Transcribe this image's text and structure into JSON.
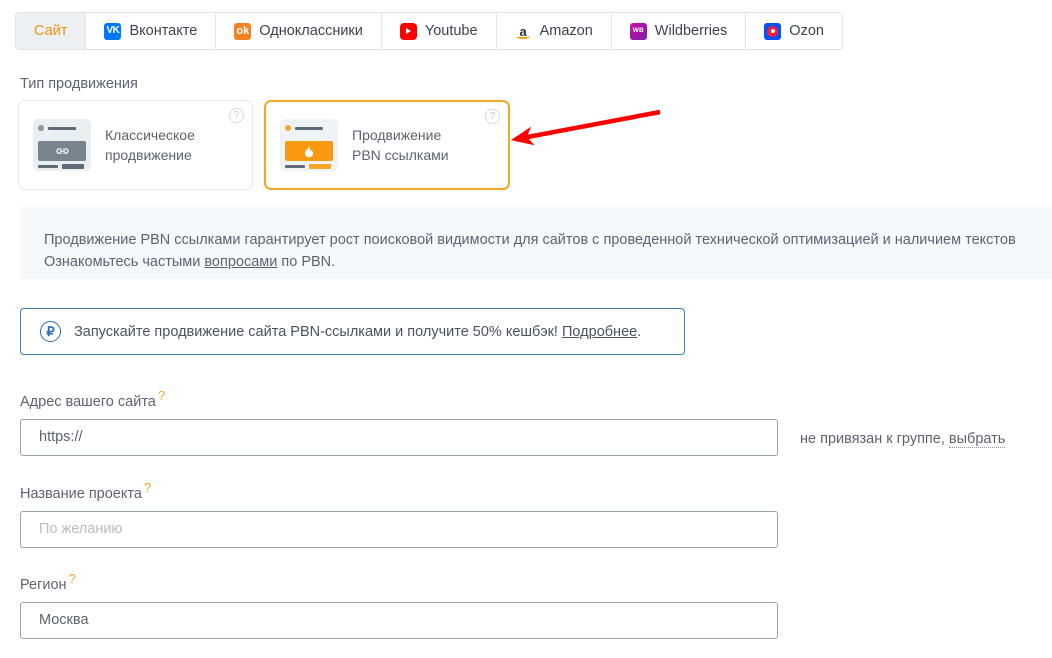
{
  "tabs": [
    {
      "label": "Сайт",
      "icon": "none",
      "active": true
    },
    {
      "label": "Вконтакте",
      "icon": "vk-icon",
      "active": false
    },
    {
      "label": "Одноклассники",
      "icon": "ok-icon",
      "active": false
    },
    {
      "label": "Youtube",
      "icon": "youtube-icon",
      "active": false
    },
    {
      "label": "Amazon",
      "icon": "amazon-icon",
      "active": false
    },
    {
      "label": "Wildberries",
      "icon": "wildberries-icon",
      "active": false
    },
    {
      "label": "Ozon",
      "icon": "ozon-icon",
      "active": false
    }
  ],
  "tab_icon_text": {
    "vk": "VK",
    "ok": "ok",
    "amazon": "a",
    "wildberries": "WB"
  },
  "promotion": {
    "section_label": "Тип продвижения",
    "cards": [
      {
        "line1": "Классическое",
        "line2": "продвижение",
        "help": "?",
        "selected": false,
        "icon": "page-with-link-icon"
      },
      {
        "line1": "Продвижение",
        "line2": "PBN ссылками",
        "help": "?",
        "selected": true,
        "icon": "page-with-flame-icon"
      }
    ]
  },
  "info_banner": {
    "line1_before": "Продвижение PBN ссылками гарантирует рост поисковой видимости для сайтов с проведенной технической оптимизацией и наличием текстов",
    "line2_before": "Ознакомьтесь частыми ",
    "line2_link": "вопросами",
    "line2_after": " по PBN."
  },
  "cashback_banner": {
    "icon": "ruble-circle-icon",
    "icon_glyph": "₽",
    "text_before": "Запускайте продвижение сайта PBN-ссылками и получите 50% кешбэк! ",
    "link": "Подробнее",
    "text_after": "."
  },
  "form": {
    "site_address": {
      "label": "Адрес вашего сайта",
      "required_marker": "?",
      "value": "https://",
      "placeholder": "https://"
    },
    "project_name": {
      "label": "Название проекта",
      "required_marker": "?",
      "value": "",
      "placeholder": "По желанию"
    },
    "region": {
      "label": "Регион",
      "required_marker": "?",
      "value": "Москва",
      "placeholder": "Москва"
    },
    "group_note": {
      "text": "не привязан к группе, ",
      "link": "выбрать"
    }
  },
  "annotation": {
    "arrow_color": "#ff0000",
    "arrow_name": "red-pointer-arrow"
  },
  "colors": {
    "accent_orange": "#f5a623",
    "tab_active_bg": "#eef1f3",
    "info_banner_bg": "#f5f9fb",
    "cashback_border": "#3e7cb8",
    "text": "#5c6470"
  }
}
